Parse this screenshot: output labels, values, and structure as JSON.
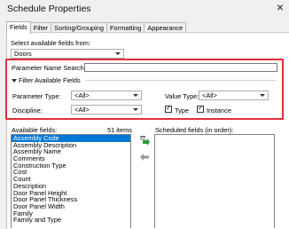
{
  "window": {
    "title": "Schedule Properties",
    "close_glyph": "×"
  },
  "tabs": [
    {
      "label": "Fields",
      "active": true
    },
    {
      "label": "Filter"
    },
    {
      "label": "Sorting/Grouping"
    },
    {
      "label": "Formatting"
    },
    {
      "label": "Appearance"
    }
  ],
  "fields": {
    "select_from_label": "Select available fields from:",
    "select_from_value": "Doors",
    "param_search_label": "Parameter Name Search:",
    "param_search_value": "",
    "filter_toggle_label": "Filter Available Fields",
    "param_type_label": "Parameter Type:",
    "param_type_value": "<All>",
    "value_type_label": "Value Type:",
    "value_type_value": "<All>",
    "discipline_label": "Discipline:",
    "discipline_value": "<All>",
    "type_checkbox_label": "Type",
    "type_checked": true,
    "instance_checkbox_label": "Instance",
    "instance_checked": true,
    "available_label": "Available fields:",
    "items_count": "51 items",
    "scheduled_label": "Scheduled fields (in order):",
    "available_items": [
      "Assembly Code",
      "Assembly Description",
      "Assembly Name",
      "Comments",
      "Construction Type",
      "Cost",
      "Count",
      "Description",
      "Door Panel Height",
      "Door Panel Thickness",
      "Door Panel Width",
      "Family",
      "Family and Type"
    ],
    "selected_index": 0
  },
  "colors": {
    "highlight": "#e0303a",
    "selection": "#0078d7",
    "add_arrow": "#2e9a3a"
  }
}
